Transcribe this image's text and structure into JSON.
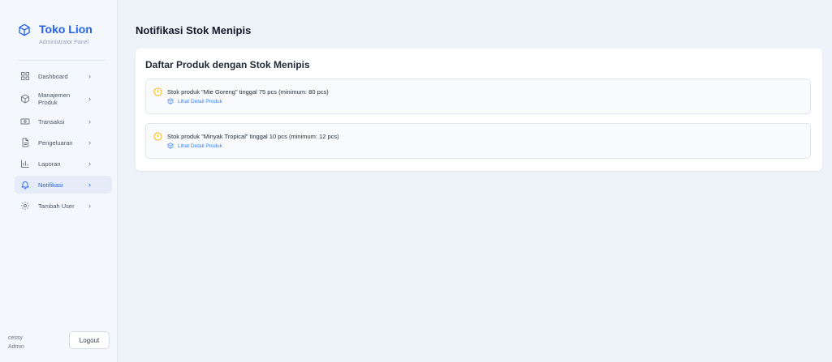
{
  "brand": {
    "title": "Toko Lion",
    "subtitle": "Administrator Panel",
    "icon": "box-icon"
  },
  "sidebar": {
    "items": [
      {
        "label": "Dashboard",
        "icon": "grid-icon"
      },
      {
        "label": "Manajemen Produk",
        "icon": "box-icon"
      },
      {
        "label": "Transaksi",
        "icon": "cash-icon"
      },
      {
        "label": "Pengeluaran",
        "icon": "document-icon"
      },
      {
        "label": "Laporan",
        "icon": "bar-chart-icon"
      },
      {
        "label": "Notifikasi",
        "icon": "bell-icon",
        "active": true
      },
      {
        "label": "Tambah User",
        "icon": "gear-icon"
      }
    ]
  },
  "user": {
    "name": "cessy",
    "role": "Admin"
  },
  "logout_label": "Logout",
  "page_title": "Notifikasi Stok Menipis",
  "card": {
    "title": "Daftar Produk dengan Stok Menipis",
    "notifications": [
      {
        "message": "Stok produk \"Mie Goreng\" tinggal 75 pcs (minimum: 80 pcs)",
        "link": "Lihat Detail Produk"
      },
      {
        "message": "Stok produk \"Minyak Tropical\" tinggal 10 pcs (minimum: 12 pcs)",
        "link": "Lihat Detail Produk"
      }
    ]
  },
  "colors": {
    "accent": "#2563eb",
    "warning": "#f5b400",
    "background": "#eef2f9"
  }
}
